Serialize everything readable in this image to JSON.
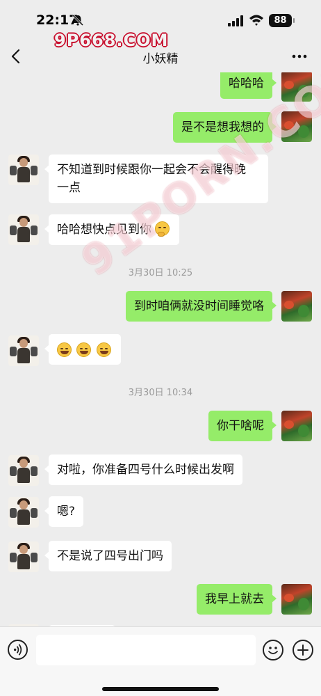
{
  "status_bar": {
    "time": "22:17",
    "battery": "88",
    "watermark": "9P668.COM"
  },
  "nav": {
    "title": "小妖精",
    "back_icon": "chevron-left-icon",
    "more_icon": "ellipsis-icon"
  },
  "chat": {
    "watermark": "91PORN.COM",
    "messages": [
      {
        "side": "out",
        "text": "哈哈哈"
      },
      {
        "side": "out",
        "text": "是不是想我想的"
      },
      {
        "side": "in",
        "line1": "不知道到时候跟你一起会不会醒得晚",
        "line2": "一点"
      },
      {
        "side": "in",
        "text": "哈哈想快点见到你",
        "emoji": "thinking-face-emoji"
      },
      {
        "type": "time",
        "text": "3月30日 10:25"
      },
      {
        "side": "out",
        "text": "到时咱俩就没时间睡觉咯"
      },
      {
        "side": "in",
        "emojis": [
          "laughing-tears-emoji",
          "laughing-tears-emoji",
          "laughing-tears-emoji"
        ]
      },
      {
        "type": "time",
        "text": "3月30日 10:34"
      },
      {
        "side": "out",
        "text": "你干啥呢"
      },
      {
        "side": "in",
        "text": "对啦，你准备四号什么时候出发啊"
      },
      {
        "side": "in",
        "text": "嗯?"
      },
      {
        "side": "in",
        "text": "不是说了四号出门吗"
      },
      {
        "side": "out",
        "text": "我早上就去"
      }
    ]
  },
  "input_bar": {
    "placeholder": "",
    "voice_icon": "voice-icon",
    "emoji_icon": "smiley-icon",
    "plus_icon": "plus-icon"
  },
  "colors": {
    "background": "#ededed",
    "outgoing_bubble": "#95ec69",
    "incoming_bubble": "#ffffff",
    "watermark_red": "#c8102e"
  }
}
